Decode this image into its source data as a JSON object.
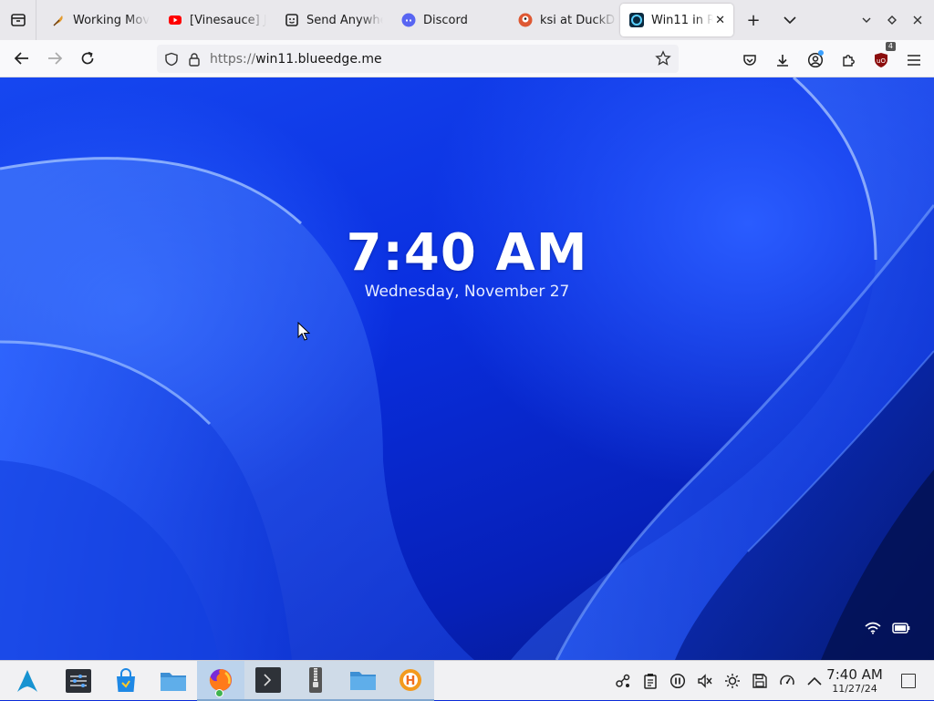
{
  "browser": {
    "tabs": [
      {
        "title": "Working Mov",
        "icon": "feather-icon"
      },
      {
        "title": "[Vinesauce] J",
        "icon": "youtube-icon"
      },
      {
        "title": "Send Anywhe",
        "icon": "send-anywhere-icon"
      },
      {
        "title": "Discord",
        "icon": "discord-icon"
      },
      {
        "title": "ksi at DuckD",
        "icon": "duckduckgo-icon"
      },
      {
        "title": "Win11 in R",
        "icon": "win11-icon",
        "active": true
      }
    ],
    "new_tab_symbol": "+",
    "close_symbol": "✕",
    "url": {
      "scheme": "https://",
      "host": "win11.blueedge.me"
    },
    "ublock_count": "4"
  },
  "lockscreen": {
    "time": "7:40 AM",
    "date": "Wednesday, November 27"
  },
  "taskbar": {
    "apps": [
      {
        "name": "launcher",
        "icon": "arch-logo-icon"
      },
      {
        "name": "settings",
        "icon": "sliders-icon"
      },
      {
        "name": "store",
        "icon": "store-bag-icon"
      },
      {
        "name": "files",
        "icon": "folder-icon"
      },
      {
        "name": "firefox",
        "icon": "firefox-icon",
        "open": true
      },
      {
        "name": "terminal",
        "icon": "terminal-icon",
        "open": true
      },
      {
        "name": "archive",
        "icon": "archive-icon",
        "open": true
      },
      {
        "name": "file-manager",
        "icon": "folder-icon",
        "open": true
      },
      {
        "name": "hoppscotch",
        "icon": "app-h-icon",
        "open": true
      }
    ],
    "clock": {
      "time": "7:40 AM",
      "date": "11/27/24"
    }
  },
  "colors": {
    "accent": "#0a2ad8",
    "tabbar_bg": "#e9e8ec",
    "taskbar_bg": "#f1f1f3"
  }
}
